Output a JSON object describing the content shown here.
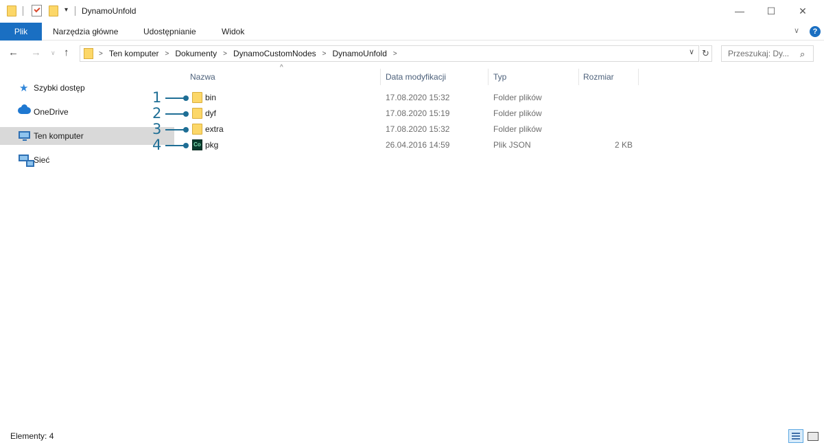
{
  "window": {
    "title": "DynamoUnfold",
    "minimize_glyph": "—",
    "maximize_glyph": "☐",
    "close_glyph": "✕"
  },
  "ribbon": {
    "tabs": [
      "Plik",
      "Narzędzia główne",
      "Udostępnianie",
      "Widok"
    ],
    "help_glyph": "?"
  },
  "address": {
    "crumbs": [
      "Ten komputer",
      "Dokumenty",
      "DynamoCustomNodes",
      "DynamoUnfold"
    ],
    "search_placeholder": "Przeszukaj: Dy..."
  },
  "nav_pane": {
    "items": [
      {
        "label": "Szybki dostęp",
        "icon": "star-icon"
      },
      {
        "label": "OneDrive",
        "icon": "cloud-icon"
      },
      {
        "label": "Ten komputer",
        "icon": "computer-icon",
        "selected": true
      },
      {
        "label": "Sieć",
        "icon": "network-icon"
      }
    ]
  },
  "columns": {
    "name": "Nazwa",
    "date": "Data modyfikacji",
    "type": "Typ",
    "size": "Rozmiar"
  },
  "files": [
    {
      "name": "bin",
      "date": "17.08.2020 15:32",
      "type": "Folder plików",
      "size": "",
      "icon": "folder-icon"
    },
    {
      "name": "dyf",
      "date": "17.08.2020 15:19",
      "type": "Folder plików",
      "size": "",
      "icon": "folder-icon"
    },
    {
      "name": "extra",
      "date": "17.08.2020 15:32",
      "type": "Folder plików",
      "size": "",
      "icon": "folder-icon"
    },
    {
      "name": "pkg",
      "date": "26.04.2016 14:59",
      "type": "Plik JSON",
      "size": "2 KB",
      "icon": "json-file-icon"
    }
  ],
  "file_icon_text": "Co",
  "callouts": [
    "1",
    "2",
    "3",
    "4"
  ],
  "status": {
    "items_text": "Elementy: 4"
  }
}
